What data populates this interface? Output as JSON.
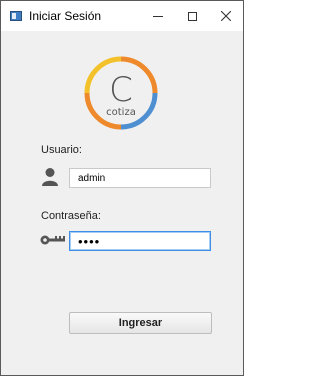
{
  "window": {
    "title": "Iniciar Sesión",
    "icon": "app-window-icon",
    "controls": [
      "minimize-icon",
      "maximize-icon",
      "close-icon"
    ]
  },
  "logo": {
    "letter": "C",
    "text": "cotiza",
    "colors": {
      "yellow": "#f3c12a",
      "orange": "#ee8a2b",
      "blue": "#4e8fd1",
      "letter": "#555555"
    }
  },
  "form": {
    "user_label": "Usuario:",
    "user_value": "admin",
    "user_icon": "user-icon",
    "pass_label": "Contraseña:",
    "pass_value": "••••",
    "pass_icon": "key-icon",
    "submit_label": "Ingresar"
  }
}
